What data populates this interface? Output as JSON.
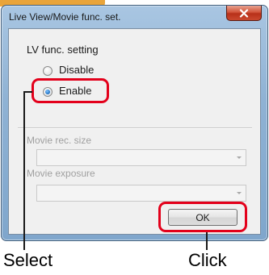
{
  "window": {
    "title": "Live View/Movie func. set.",
    "close_icon": "close-x-icon"
  },
  "lv_group": {
    "heading": "LV func. setting",
    "options": [
      {
        "label": "Disable",
        "selected": false
      },
      {
        "label": "Enable",
        "selected": true
      }
    ]
  },
  "movie": {
    "rec_size_label": "Movie rec. size",
    "rec_size_value": "",
    "exposure_label": "Movie exposure",
    "exposure_value": ""
  },
  "buttons": {
    "ok_label": "OK"
  },
  "annotations": {
    "select_caption": "Select",
    "click_caption": "Click",
    "highlight_color": "#e3001b"
  }
}
